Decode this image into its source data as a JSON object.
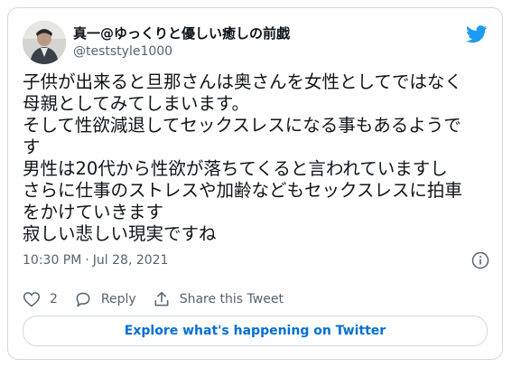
{
  "author": {
    "display_name": "真一@ゆっくりと優しい癒しの前戯",
    "handle": "@teststyle1000"
  },
  "tweet": {
    "text": "子供が出来ると旦那さんは奥さんを女性としてではなく\n母親としてみてしまいます。\nそして性欲減退してセックスレスになる事もあるようで\nす\n男性は20代から性欲が落ちてくると言われていますし\nさらに仕事のストレスや加齢などもセックスレスに拍車\nをかけていきます\n寂しい悲しい現実ですね",
    "time": "10:30 PM",
    "separator": "·",
    "date": "Jul 28, 2021"
  },
  "actions": {
    "like_count": "2",
    "reply_label": "Reply",
    "share_label": "Share this Tweet"
  },
  "explore_button": "Explore what's happening on Twitter",
  "icons": {
    "brand": "twitter-bird-icon",
    "info": "info-icon",
    "like": "heart-icon",
    "reply": "reply-bubble-icon",
    "share": "share-upload-icon"
  },
  "colors": {
    "twitter_blue": "#1d9bf0",
    "link_blue": "#006fd6",
    "secondary_text": "#536471",
    "border": "#cfd9de"
  }
}
